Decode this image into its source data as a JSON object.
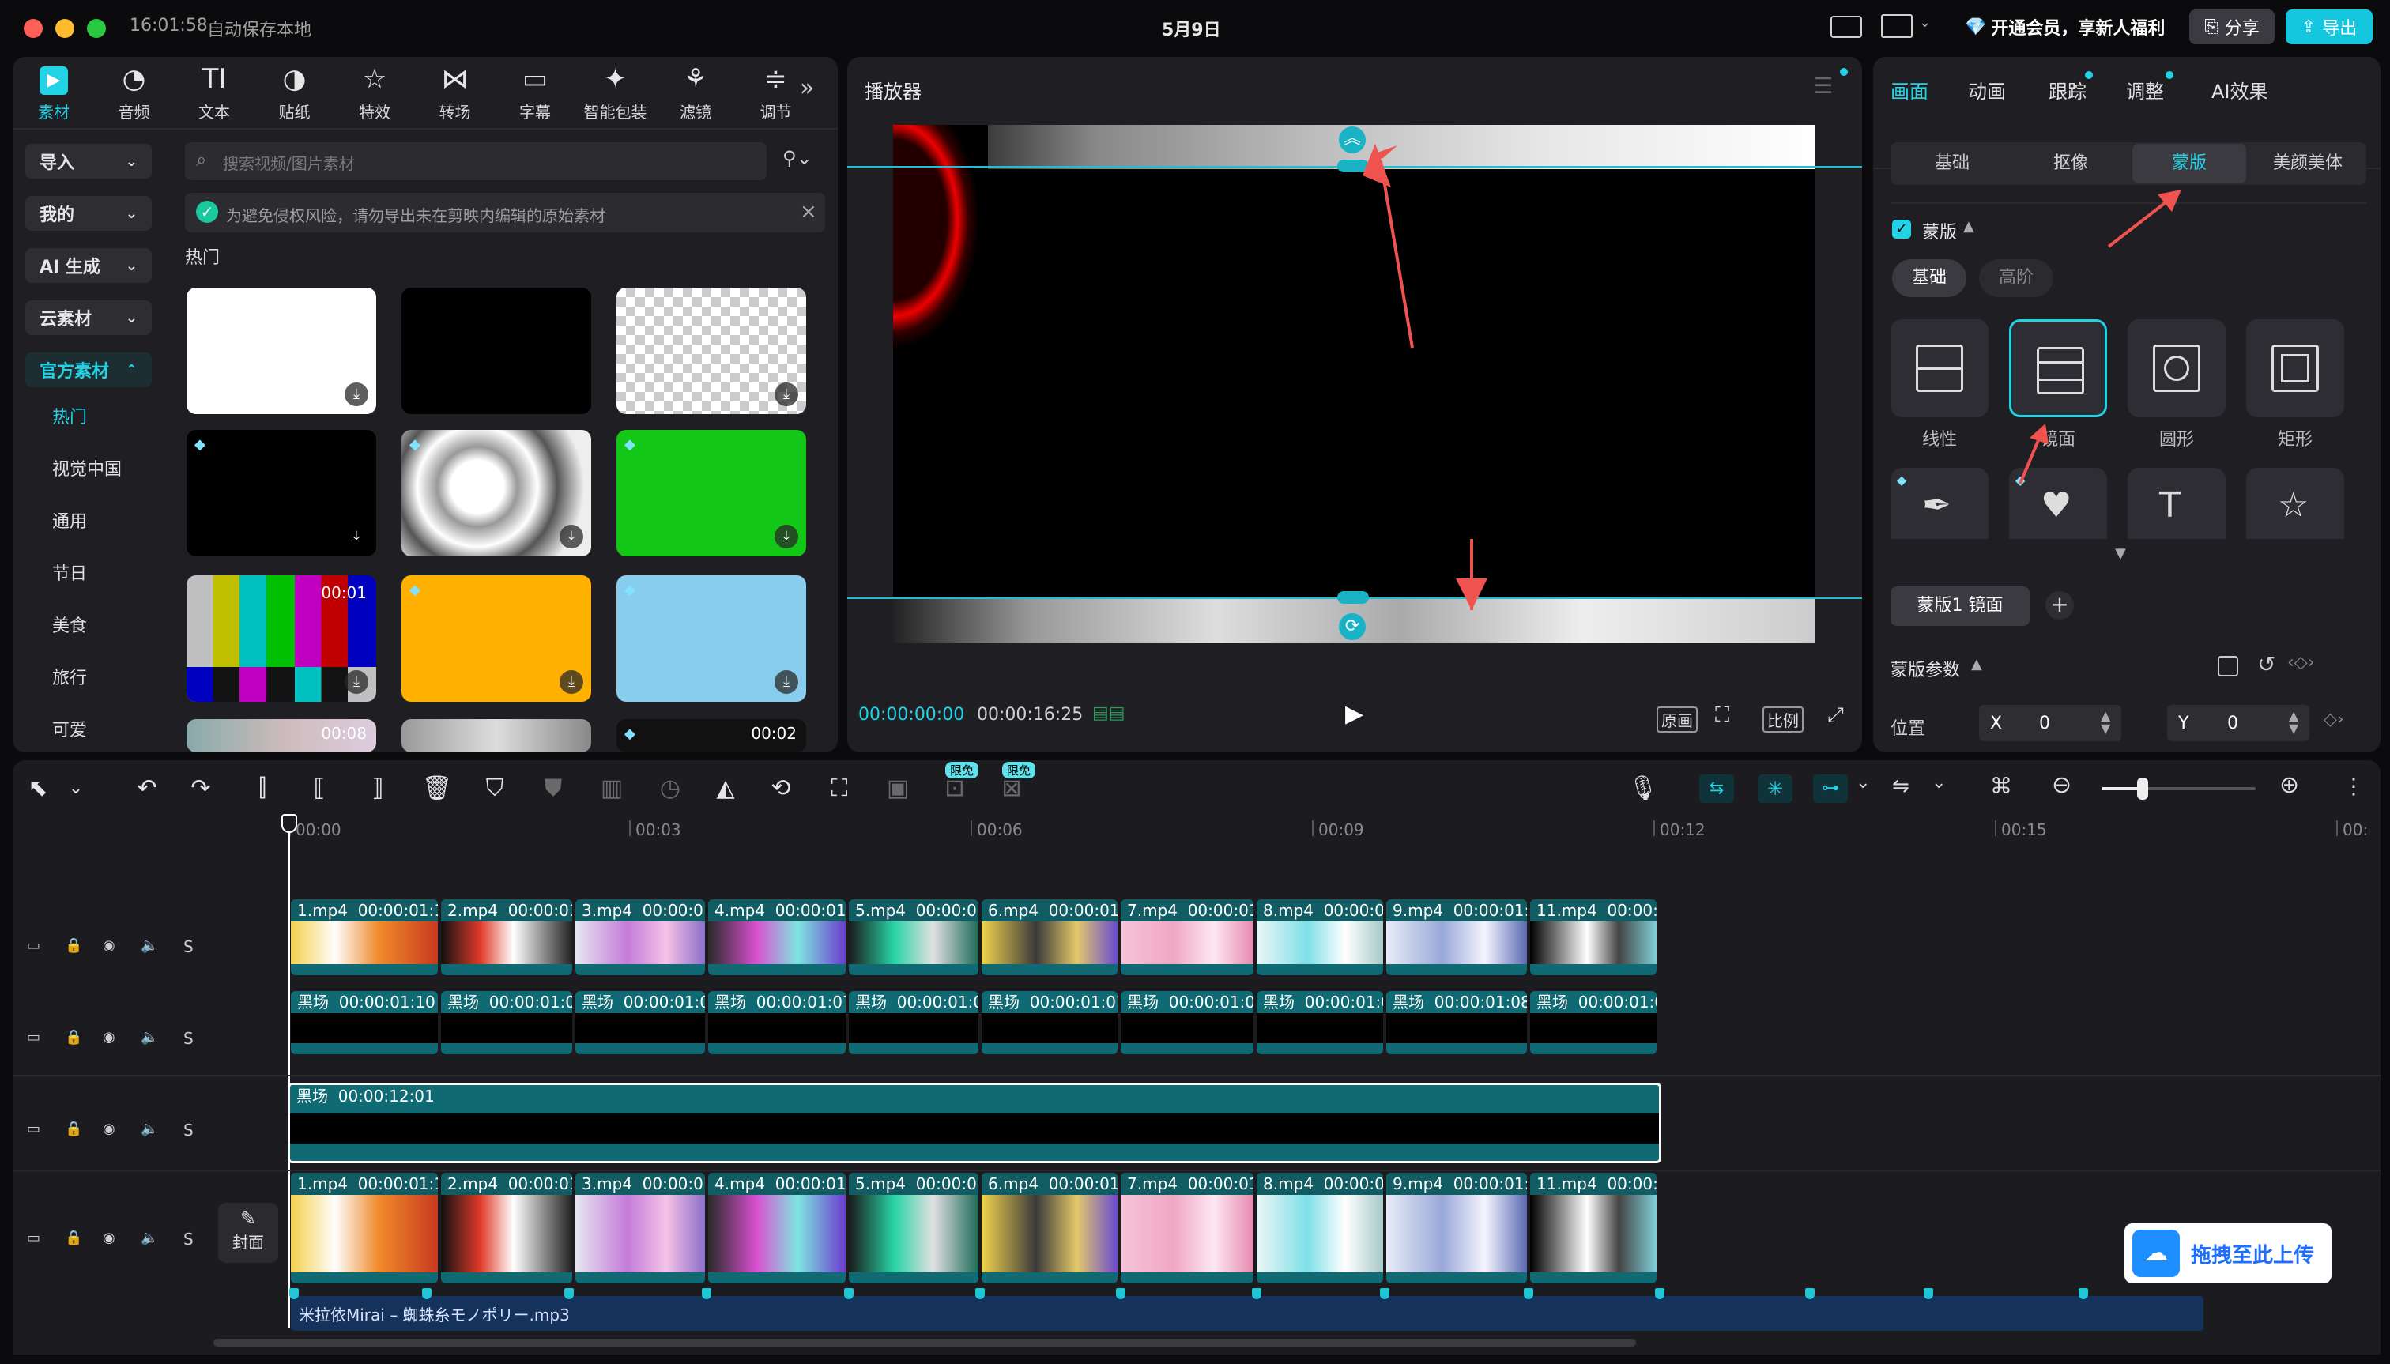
{
  "titlebar": {
    "time": "16:01:58",
    "autosave": "自动保存本地",
    "project": "5月9日",
    "vip": "开通会员，享新人福利",
    "share": "分享",
    "export": "导出"
  },
  "toolbar_tabs": [
    {
      "label": "素材",
      "icon": "media-icon"
    },
    {
      "label": "音频",
      "icon": "audio-icon"
    },
    {
      "label": "文本",
      "icon": "text-icon"
    },
    {
      "label": "贴纸",
      "icon": "sticker-icon"
    },
    {
      "label": "特效",
      "icon": "effects-icon"
    },
    {
      "label": "转场",
      "icon": "transition-icon"
    },
    {
      "label": "字幕",
      "icon": "caption-icon"
    },
    {
      "label": "智能包装",
      "icon": "smart-pack-icon"
    },
    {
      "label": "滤镜",
      "icon": "filter-icon"
    },
    {
      "label": "调节",
      "icon": "adjust-icon"
    }
  ],
  "left_nav": {
    "dropdowns": [
      "导入",
      "我的",
      "AI 生成",
      "云素材",
      "官方素材"
    ],
    "items": [
      "热门",
      "视觉中国",
      "通用",
      "节日",
      "美食",
      "旅行",
      "可爱"
    ]
  },
  "media": {
    "search_placeholder": "搜索视频/图片素材",
    "notice": "为避免侵权风险，请勿导出未在剪映内编辑的原始素材",
    "section": "热门",
    "thumb_durations": [
      "00:01",
      "00:08",
      "00:02"
    ]
  },
  "player": {
    "title": "播放器",
    "current_time": "00:00:00:00",
    "total_time": "00:00:16:25",
    "btn_original": "原画",
    "btn_ratio": "比例"
  },
  "inspector": {
    "tabs": [
      "画面",
      "动画",
      "跟踪",
      "调整",
      "AI效果"
    ],
    "subtabs": [
      "基础",
      "抠像",
      "蒙版",
      "美颜美体"
    ],
    "mask_title": "蒙版",
    "mask_modes": [
      "基础",
      "高阶"
    ],
    "mask_shapes": [
      "线性",
      "镜面",
      "圆形",
      "矩形"
    ],
    "mask_chip": "蒙版1 镜面",
    "params_title": "蒙版参数",
    "position_label": "位置",
    "x_label": "X",
    "x_value": "0",
    "y_label": "Y",
    "y_value": "0"
  },
  "timeline": {
    "badges": [
      "限免",
      "限免"
    ],
    "ruler": [
      "00:00",
      "00:03",
      "00:06",
      "00:09",
      "00:12",
      "00:15",
      "00:"
    ],
    "track_s": "S",
    "cover": "封面",
    "row1": [
      {
        "name": "1.mp4",
        "dur": "00:00:01:10"
      },
      {
        "name": "2.mp4",
        "dur": "00:00:01"
      },
      {
        "name": "3.mp4",
        "dur": "00:00:01"
      },
      {
        "name": "4.mp4",
        "dur": "00:00:01:("
      },
      {
        "name": "5.mp4",
        "dur": "00:00:01"
      },
      {
        "name": "6.mp4",
        "dur": "00:00:01:("
      },
      {
        "name": "7.mp4",
        "dur": "00:00:01:("
      },
      {
        "name": "8.mp4",
        "dur": "00:00:01"
      },
      {
        "name": "9.mp4",
        "dur": "00:00:01:0"
      },
      {
        "name": "11.mp4",
        "dur": "00:00:0"
      }
    ],
    "row2": [
      {
        "name": "黑场",
        "dur": "00:00:01:10"
      },
      {
        "name": "黑场",
        "dur": "00:00:01:0"
      },
      {
        "name": "黑场",
        "dur": "00:00:01:0"
      },
      {
        "name": "黑场",
        "dur": "00:00:01:07"
      },
      {
        "name": "黑场",
        "dur": "00:00:01:0"
      },
      {
        "name": "黑场",
        "dur": "00:00:01:07"
      },
      {
        "name": "黑场",
        "dur": "00:00:01:06"
      },
      {
        "name": "黑场",
        "dur": "00:00:01:0"
      },
      {
        "name": "黑场",
        "dur": "00:00:01:08"
      },
      {
        "name": "黑场",
        "dur": "00:00:01:0"
      }
    ],
    "row3": {
      "name": "黑场",
      "dur": "00:00:12:01"
    },
    "row4": [
      {
        "name": "1.mp4",
        "dur": "00:00:01:10"
      },
      {
        "name": "2.mp4",
        "dur": "00:00:01"
      },
      {
        "name": "3.mp4",
        "dur": "00:00:01"
      },
      {
        "name": "4.mp4",
        "dur": "00:00:01:("
      },
      {
        "name": "5.mp4",
        "dur": "00:00:01"
      },
      {
        "name": "6.mp4",
        "dur": "00:00:01:("
      },
      {
        "name": "7.mp4",
        "dur": "00:00:01:("
      },
      {
        "name": "8.mp4",
        "dur": "00:00:01"
      },
      {
        "name": "9.mp4",
        "dur": "00:00:01:0"
      },
      {
        "name": "11.mp4",
        "dur": "00:00:0"
      }
    ],
    "audio": "米拉依Mirai – 蜘蛛糸モノポリー.mp3",
    "upload": "拖拽至此上传"
  },
  "colors": {
    "accent": "#22d3e6",
    "arrow": "#f0524f",
    "clip": "#0f6a73",
    "audio": "#14325a"
  }
}
